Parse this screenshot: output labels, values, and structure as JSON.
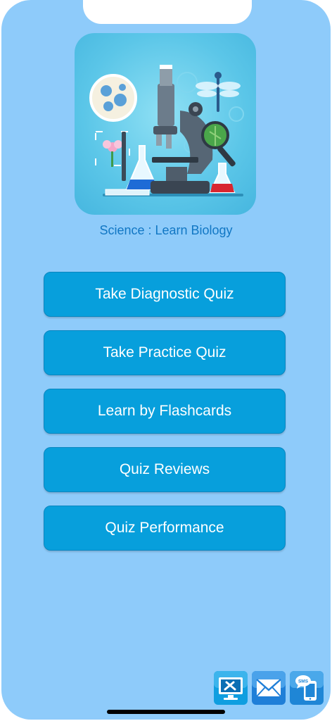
{
  "app": {
    "title": "Science : Learn Biology",
    "icon": "microscope-app-icon"
  },
  "menu": [
    {
      "label": "Take Diagnostic Quiz"
    },
    {
      "label": "Take Practice Quiz"
    },
    {
      "label": "Learn by Flashcards"
    },
    {
      "label": "Quiz Reviews"
    },
    {
      "label": "Quiz Performance"
    }
  ],
  "dock": [
    {
      "icon": "tools-monitor-icon"
    },
    {
      "icon": "mail-icon"
    },
    {
      "icon": "sms-phone-icon",
      "label": "SMS"
    }
  ],
  "colors": {
    "background": "#8ecbfa",
    "button": "#079fdc",
    "title": "#1177c4"
  }
}
